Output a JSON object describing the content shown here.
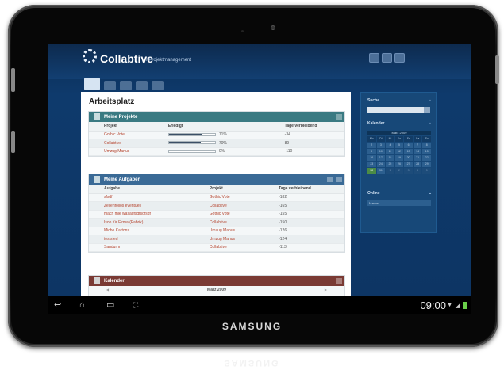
{
  "app": {
    "name": "Collabtive",
    "subtitle": "/ Projektmanagement"
  },
  "page": {
    "title": "Arbeitsplatz"
  },
  "projects": {
    "title": "Meine Projekte",
    "headers": [
      "Projekt",
      "Erledigt",
      "Tage verbleibend"
    ],
    "rows": [
      {
        "name": "Gothic Vote",
        "progress_pct": 71,
        "progress_label": "71%",
        "days": "-34"
      },
      {
        "name": "Collabtive",
        "progress_pct": 70,
        "progress_label": "70%",
        "days": "89"
      },
      {
        "name": "Umzug Manus",
        "progress_pct": 0,
        "progress_label": "0%",
        "days": "-110"
      }
    ]
  },
  "tasks": {
    "title": "Meine Aufgaben",
    "headers": [
      "Aufgabe",
      "Projekt",
      "Tage verbleibend"
    ],
    "rows": [
      {
        "task": "sfsdf",
        "project": "Gothic Vote",
        "days": "-182"
      },
      {
        "task": "Zeilenfolios eventuell",
        "project": "Collabtive",
        "days": "-165"
      },
      {
        "task": "mach mie wasadfsdfsdfsdf",
        "project": "Gothic Vote",
        "days": "-155"
      },
      {
        "task": "Ison für Firma (Fabrik)",
        "project": "Collabtive",
        "days": "-150"
      },
      {
        "task": "Miche Kartons",
        "project": "Umzug Manus",
        "days": "-126"
      },
      {
        "task": "testsfed",
        "project": "Umzug Manus",
        "days": "-124"
      },
      {
        "task": "Sandurhr",
        "project": "Collabtive",
        "days": "-113"
      }
    ]
  },
  "calendar_box": {
    "title": "Kalender",
    "month": "März 2009"
  },
  "sidebar": {
    "search_title": "Suche",
    "calendar_title": "Kalender",
    "calendar_month": "März 2009",
    "weekdays": [
      "Mo",
      "Di",
      "Mi",
      "Do",
      "Fr",
      "Sa",
      "So"
    ],
    "days": [
      "2",
      "3",
      "4",
      "5",
      "6",
      "7",
      "8",
      "9",
      "10",
      "11",
      "12",
      "13",
      "14",
      "15",
      "16",
      "17",
      "18",
      "19",
      "20",
      "21",
      "22",
      "23",
      "24",
      "25",
      "26",
      "27",
      "28",
      "29",
      "30",
      "31",
      "1",
      "2",
      "3",
      "4",
      "5"
    ],
    "today": "30",
    "online_title": "Online",
    "online_user": "Manus"
  },
  "system_bar": {
    "time": "09:00"
  },
  "device": {
    "brand": "SAMSUNG"
  }
}
